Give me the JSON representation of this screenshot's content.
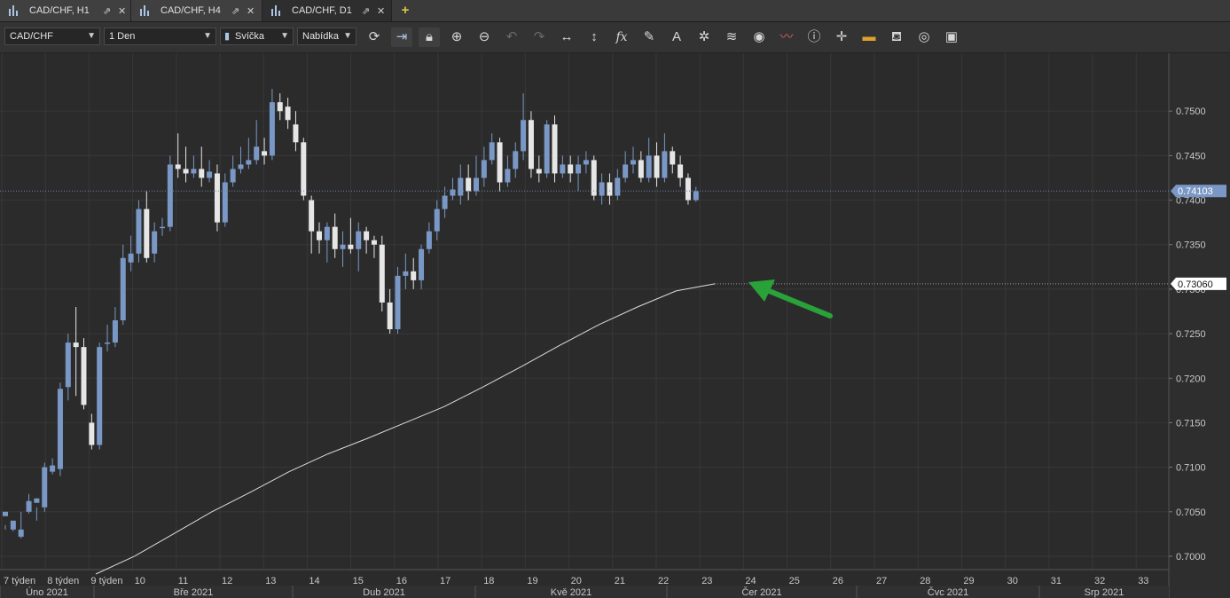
{
  "tabs": [
    {
      "label": "CAD/CHF, H1",
      "active": false
    },
    {
      "label": "CAD/CHF, H4",
      "active": false
    },
    {
      "label": "CAD/CHF, D1",
      "active": true
    }
  ],
  "toolbar": {
    "symbol": "CAD/CHF",
    "timeframe": "1 Den",
    "chart_type": "Svíčka",
    "price_type": "Nabídka",
    "icons": [
      "refresh-icon",
      "autoscroll-icon",
      "lock-icon",
      "zoom-in-icon",
      "zoom-out-icon",
      "undo-icon",
      "redo-icon",
      "horizontal-scale-icon",
      "vertical-scale-icon",
      "indicators-fx-icon",
      "draw-pencil-icon",
      "text-tool-icon",
      "objects-icon",
      "layers-icon",
      "view-eye-icon",
      "signals-icon",
      "info-icon",
      "crosshair-icon",
      "color-theme-icon",
      "fill-bucket-icon",
      "template-circle-icon",
      "save-icon"
    ]
  },
  "chart_data": {
    "type": "candlestick",
    "symbol": "CAD/CHF",
    "timeframe": "D1",
    "ylim": [
      0.6985,
      0.7565
    ],
    "y_ticks": [
      "0.7500",
      "0.7450",
      "0.7400",
      "0.7350",
      "0.7300",
      "0.7250",
      "0.7200",
      "0.7150",
      "0.7100",
      "0.7050",
      "0.7000"
    ],
    "current_price_label": "0.74103",
    "current_price": 0.74103,
    "indicator_value_label": "0.73060",
    "indicator_value": 0.7306,
    "week_labels": [
      "7 týden",
      "8 týden",
      "9 týden",
      "10",
      "11",
      "12",
      "13",
      "14",
      "15",
      "16",
      "17",
      "18",
      "19",
      "20",
      "21",
      "22",
      "23",
      "24",
      "25",
      "26",
      "27",
      "28",
      "29",
      "30",
      "31",
      "32",
      "33"
    ],
    "month_labels": [
      "Úno 2021",
      "Bře 2021",
      "Dub 2021",
      "Kvě 2021",
      "Čer 2021",
      "Čvc 2021",
      "Srp 2021"
    ],
    "candles": [
      [
        0.7045,
        0.705,
        0.7035,
        0.703
      ],
      [
        0.703,
        0.704,
        0.7028,
        0.703
      ],
      [
        0.7022,
        0.703,
        0.705,
        0.702
      ],
      [
        0.705,
        0.7062,
        0.707,
        0.7048
      ],
      [
        0.706,
        0.7065,
        0.7055,
        0.704
      ],
      [
        0.7055,
        0.71,
        0.7105,
        0.705
      ],
      [
        0.7095,
        0.7102,
        0.711,
        0.7092
      ],
      [
        0.7098,
        0.7188,
        0.7195,
        0.709
      ],
      [
        0.719,
        0.724,
        0.725,
        0.7175
      ],
      [
        0.724,
        0.7235,
        0.728,
        0.718
      ],
      [
        0.7235,
        0.717,
        0.7245,
        0.7165
      ],
      [
        0.715,
        0.7125,
        0.716,
        0.712
      ],
      [
        0.7125,
        0.7235,
        0.724,
        0.712
      ],
      [
        0.724,
        0.724,
        0.726,
        0.723
      ],
      [
        0.724,
        0.7265,
        0.728,
        0.7235
      ],
      [
        0.7265,
        0.7335,
        0.735,
        0.726
      ],
      [
        0.733,
        0.734,
        0.736,
        0.732
      ],
      [
        0.734,
        0.739,
        0.74,
        0.733
      ],
      [
        0.739,
        0.7335,
        0.741,
        0.733
      ],
      [
        0.734,
        0.7365,
        0.7375,
        0.733
      ],
      [
        0.737,
        0.737,
        0.738,
        0.736
      ],
      [
        0.737,
        0.744,
        0.745,
        0.7365
      ],
      [
        0.744,
        0.7435,
        0.7475,
        0.7425
      ],
      [
        0.7435,
        0.743,
        0.746,
        0.742
      ],
      [
        0.743,
        0.7435,
        0.745,
        0.7425
      ],
      [
        0.7435,
        0.7425,
        0.746,
        0.7415
      ],
      [
        0.7425,
        0.7432,
        0.7445,
        0.742
      ],
      [
        0.743,
        0.7375,
        0.744,
        0.7365
      ],
      [
        0.7375,
        0.742,
        0.743,
        0.737
      ],
      [
        0.742,
        0.7435,
        0.745,
        0.7415
      ],
      [
        0.7435,
        0.744,
        0.746,
        0.743
      ],
      [
        0.744,
        0.7445,
        0.747,
        0.7435
      ],
      [
        0.7445,
        0.746,
        0.749,
        0.744
      ],
      [
        0.7455,
        0.745,
        0.747,
        0.744
      ],
      [
        0.745,
        0.751,
        0.7525,
        0.7445
      ],
      [
        0.751,
        0.75,
        0.752,
        0.749
      ],
      [
        0.7505,
        0.749,
        0.7515,
        0.748
      ],
      [
        0.7485,
        0.7465,
        0.75,
        0.7455
      ],
      [
        0.7465,
        0.7405,
        0.747,
        0.74
      ],
      [
        0.74,
        0.7365,
        0.7405,
        0.734
      ],
      [
        0.7365,
        0.7355,
        0.7375,
        0.734
      ],
      [
        0.7355,
        0.737,
        0.7375,
        0.733
      ],
      [
        0.737,
        0.7345,
        0.7385,
        0.7335
      ],
      [
        0.7345,
        0.735,
        0.7365,
        0.7325
      ],
      [
        0.735,
        0.7345,
        0.738,
        0.734
      ],
      [
        0.7345,
        0.7365,
        0.7375,
        0.732
      ],
      [
        0.7365,
        0.7355,
        0.737,
        0.734
      ],
      [
        0.7355,
        0.735,
        0.736,
        0.7335
      ],
      [
        0.735,
        0.7285,
        0.736,
        0.7275
      ],
      [
        0.7285,
        0.7255,
        0.73,
        0.725
      ],
      [
        0.7255,
        0.7315,
        0.7325,
        0.725
      ],
      [
        0.7315,
        0.732,
        0.734,
        0.73
      ],
      [
        0.732,
        0.731,
        0.7335,
        0.73
      ],
      [
        0.731,
        0.7345,
        0.735,
        0.73
      ],
      [
        0.7345,
        0.7365,
        0.7375,
        0.734
      ],
      [
        0.7365,
        0.739,
        0.74,
        0.7355
      ],
      [
        0.739,
        0.7405,
        0.7415,
        0.738
      ],
      [
        0.7405,
        0.7412,
        0.7425,
        0.74
      ],
      [
        0.7405,
        0.7425,
        0.744,
        0.7395
      ],
      [
        0.7425,
        0.741,
        0.744,
        0.74
      ],
      [
        0.741,
        0.7425,
        0.745,
        0.7405
      ],
      [
        0.7425,
        0.7445,
        0.746,
        0.7415
      ],
      [
        0.7445,
        0.7465,
        0.7475,
        0.744
      ],
      [
        0.7465,
        0.742,
        0.747,
        0.741
      ],
      [
        0.742,
        0.7435,
        0.745,
        0.7415
      ],
      [
        0.7435,
        0.7455,
        0.7465,
        0.7425
      ],
      [
        0.7455,
        0.749,
        0.752,
        0.7445
      ],
      [
        0.749,
        0.7435,
        0.75,
        0.7425
      ],
      [
        0.7435,
        0.743,
        0.745,
        0.742
      ],
      [
        0.743,
        0.7485,
        0.749,
        0.7425
      ],
      [
        0.7485,
        0.743,
        0.7495,
        0.742
      ],
      [
        0.743,
        0.744,
        0.745,
        0.7425
      ],
      [
        0.744,
        0.743,
        0.745,
        0.742
      ],
      [
        0.743,
        0.744,
        0.745,
        0.741
      ],
      [
        0.744,
        0.7445,
        0.7455,
        0.743
      ],
      [
        0.7445,
        0.7405,
        0.745,
        0.74
      ],
      [
        0.7405,
        0.742,
        0.743,
        0.7395
      ],
      [
        0.742,
        0.7405,
        0.743,
        0.7395
      ],
      [
        0.7405,
        0.7425,
        0.7435,
        0.74
      ],
      [
        0.7425,
        0.744,
        0.7455,
        0.742
      ],
      [
        0.744,
        0.7445,
        0.746,
        0.743
      ],
      [
        0.7445,
        0.7425,
        0.7455,
        0.742
      ],
      [
        0.7425,
        0.745,
        0.747,
        0.742
      ],
      [
        0.745,
        0.7425,
        0.7465,
        0.7415
      ],
      [
        0.7425,
        0.7455,
        0.7475,
        0.742
      ],
      [
        0.7455,
        0.744,
        0.746,
        0.743
      ],
      [
        0.744,
        0.7425,
        0.745,
        0.7415
      ],
      [
        0.7425,
        0.74,
        0.743,
        0.7395
      ],
      [
        0.74,
        0.741,
        0.7415,
        0.7398
      ]
    ],
    "sma_series_label": "0.73060",
    "sma_values": [
      0.698,
      0.7,
      0.7025,
      0.705,
      0.7072,
      0.7095,
      0.7115,
      0.7132,
      0.715,
      0.7168,
      0.719,
      0.7213,
      0.7237,
      0.726,
      0.728,
      0.7298,
      0.7306
    ],
    "annotation": "green arrow pointing at indicator end value",
    "colors": {
      "bull": "#7a98c6",
      "bear": "#e6e6e6",
      "grid": "#383838",
      "sma": "#dcdcdc",
      "price_tag": "#7a98c6",
      "arrow": "#2aa23a",
      "bg": "#2b2b2b"
    }
  }
}
